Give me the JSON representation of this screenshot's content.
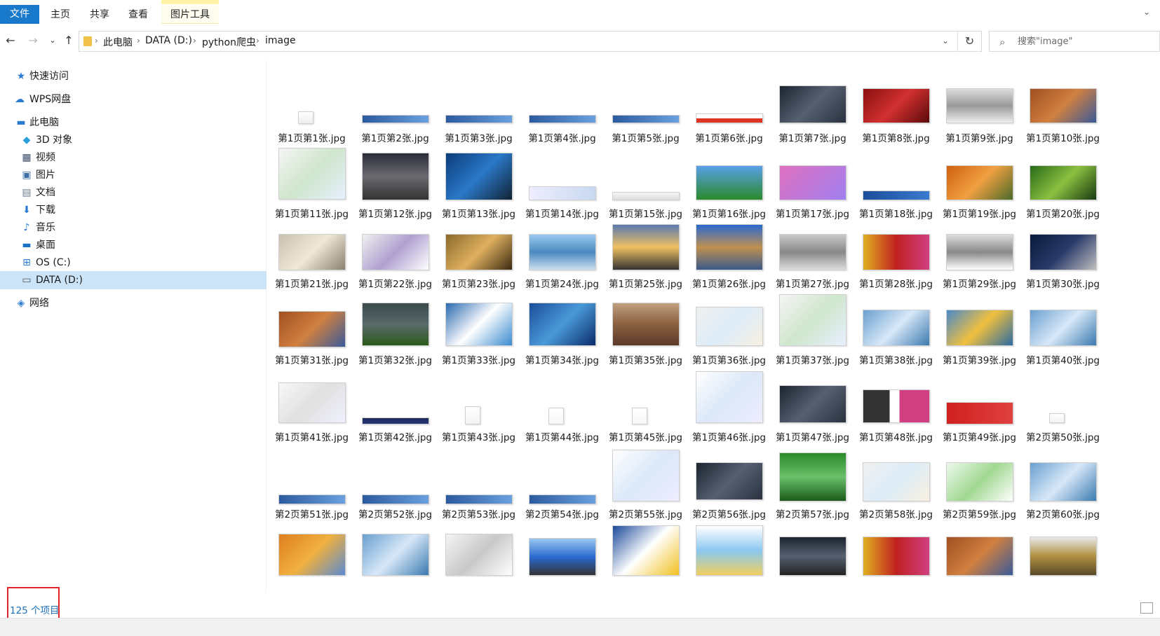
{
  "ribbon": {
    "tabs": [
      {
        "label": "文件"
      },
      {
        "label": "主页"
      },
      {
        "label": "共享"
      },
      {
        "label": "查看"
      },
      {
        "label": "图片工具"
      }
    ]
  },
  "address": {
    "crumbs": [
      "此电脑",
      "DATA (D:)",
      "python爬虫",
      "image"
    ]
  },
  "search": {
    "placeholder": "搜索\"image\""
  },
  "sidebar": {
    "items": [
      {
        "label": "快速访问",
        "icon": "star-icon"
      },
      {
        "label": "WPS网盘",
        "icon": "cloud-icon"
      },
      {
        "label": "此电脑",
        "icon": "computer-icon"
      },
      {
        "label": "3D 对象",
        "icon": "cube-icon"
      },
      {
        "label": "视频",
        "icon": "video-icon"
      },
      {
        "label": "图片",
        "icon": "image-icon"
      },
      {
        "label": "文档",
        "icon": "document-icon"
      },
      {
        "label": "下载",
        "icon": "download-icon"
      },
      {
        "label": "音乐",
        "icon": "music-icon"
      },
      {
        "label": "桌面",
        "icon": "desktop-icon"
      },
      {
        "label": "OS (C:)",
        "icon": "drive-icon"
      },
      {
        "label": "DATA (D:)",
        "icon": "drive-icon"
      },
      {
        "label": "网络",
        "icon": "network-icon"
      }
    ]
  },
  "files": [
    "第1页第1张.jpg",
    "第1页第2张.jpg",
    "第1页第3张.jpg",
    "第1页第4张.jpg",
    "第1页第5张.jpg",
    "第1页第6张.jpg",
    "第1页第7张.jpg",
    "第1页第8张.jpg",
    "第1页第9张.jpg",
    "第1页第10张.jpg",
    "第1页第11张.jpg",
    "第1页第12张.jpg",
    "第1页第13张.jpg",
    "第1页第14张.jpg",
    "第1页第15张.jpg",
    "第1页第16张.jpg",
    "第1页第17张.jpg",
    "第1页第18张.jpg",
    "第1页第19张.jpg",
    "第1页第20张.jpg",
    "第1页第21张.jpg",
    "第1页第22张.jpg",
    "第1页第23张.jpg",
    "第1页第24张.jpg",
    "第1页第25张.jpg",
    "第1页第26张.jpg",
    "第1页第27张.jpg",
    "第1页第28张.jpg",
    "第1页第29张.jpg",
    "第1页第30张.jpg",
    "第1页第31张.jpg",
    "第1页第32张.jpg",
    "第1页第33张.jpg",
    "第1页第34张.jpg",
    "第1页第35张.jpg",
    "第1页第36张.jpg",
    "第1页第37张.jpg",
    "第1页第38张.jpg",
    "第1页第39张.jpg",
    "第1页第40张.jpg",
    "第1页第41张.jpg",
    "第1页第42张.jpg",
    "第1页第43张.jpg",
    "第1页第44张.jpg",
    "第1页第45张.jpg",
    "第1页第46张.jpg",
    "第1页第47张.jpg",
    "第1页第48张.jpg",
    "第1页第49张.jpg",
    "第2页第50张.jpg",
    "第2页第51张.jpg",
    "第2页第52张.jpg",
    "第2页第53张.jpg",
    "第2页第54张.jpg",
    "第2页第55张.jpg",
    "第2页第56张.jpg",
    "第2页第57张.jpg",
    "第2页第58张.jpg",
    "第2页第59张.jpg",
    "第2页第60张.jpg"
  ],
  "status": {
    "count": "125 个项目"
  }
}
